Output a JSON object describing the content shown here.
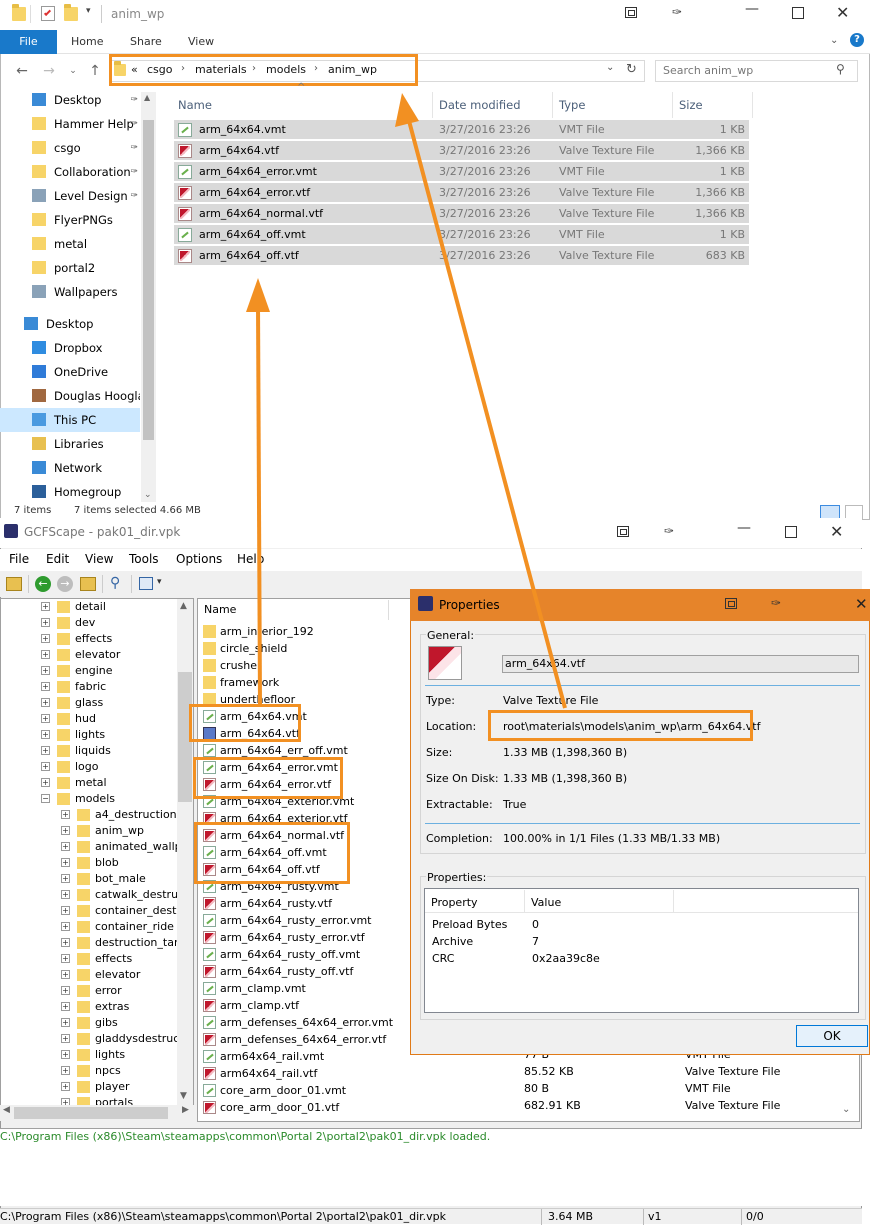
{
  "explorer": {
    "title": "anim_wp",
    "tabs": {
      "file": "File",
      "home": "Home",
      "share": "Share",
      "view": "View"
    },
    "address": {
      "prefix": "«",
      "crumbs": [
        "csgo",
        "materials",
        "models",
        "anim_wp"
      ]
    },
    "search_placeholder": "Search anim_wp",
    "nav": [
      {
        "label": "Desktop",
        "icon": "desktop-icon",
        "pinned": true
      },
      {
        "label": "Hammer Help",
        "icon": "folder-icon",
        "pinned": true
      },
      {
        "label": "csgo",
        "icon": "folder-icon",
        "pinned": true
      },
      {
        "label": "Collaboration",
        "icon": "folder-icon",
        "pinned": true
      },
      {
        "label": "Level Design",
        "icon": "users-folder-icon",
        "pinned": true
      },
      {
        "label": "FlyerPNGs",
        "icon": "folder-icon",
        "pinned": false
      },
      {
        "label": "metal",
        "icon": "folder-icon",
        "pinned": false
      },
      {
        "label": "portal2",
        "icon": "folder-icon",
        "pinned": false
      },
      {
        "label": "Wallpapers",
        "icon": "users-folder-icon",
        "pinned": false
      },
      {
        "label": "Desktop",
        "icon": "desktop-icon",
        "pinned": false
      },
      {
        "label": "Dropbox",
        "icon": "dropbox-icon",
        "pinned": false
      },
      {
        "label": "OneDrive",
        "icon": "cloud-icon",
        "pinned": false
      },
      {
        "label": "Douglas Hoogla",
        "icon": "user-icon",
        "pinned": false
      },
      {
        "label": "This PC",
        "icon": "computer-icon",
        "pinned": false
      },
      {
        "label": "Libraries",
        "icon": "library-icon",
        "pinned": false
      },
      {
        "label": "Network",
        "icon": "network-icon",
        "pinned": false
      },
      {
        "label": "Homegroup",
        "icon": "homegroup-icon",
        "pinned": false
      }
    ],
    "columns": {
      "name": "Name",
      "date": "Date modified",
      "type": "Type",
      "size": "Size"
    },
    "files": [
      {
        "name": "arm_64x64.vmt",
        "date": "3/27/2016 23:26",
        "type": "VMT File",
        "size": "1 KB",
        "kind": "vmt"
      },
      {
        "name": "arm_64x64.vtf",
        "date": "3/27/2016 23:26",
        "type": "Valve Texture File",
        "size": "1,366 KB",
        "kind": "vtf"
      },
      {
        "name": "arm_64x64_error.vmt",
        "date": "3/27/2016 23:26",
        "type": "VMT File",
        "size": "1 KB",
        "kind": "vmt"
      },
      {
        "name": "arm_64x64_error.vtf",
        "date": "3/27/2016 23:26",
        "type": "Valve Texture File",
        "size": "1,366 KB",
        "kind": "vtf"
      },
      {
        "name": "arm_64x64_normal.vtf",
        "date": "3/27/2016 23:26",
        "type": "Valve Texture File",
        "size": "1,366 KB",
        "kind": "vtf"
      },
      {
        "name": "arm_64x64_off.vmt",
        "date": "3/27/2016 23:26",
        "type": "VMT File",
        "size": "1 KB",
        "kind": "vmt"
      },
      {
        "name": "arm_64x64_off.vtf",
        "date": "3/27/2016 23:26",
        "type": "Valve Texture File",
        "size": "683 KB",
        "kind": "vtf"
      }
    ],
    "status_items": "7 items",
    "status_selected": "7 items selected  4.66 MB"
  },
  "gcf": {
    "title": "GCFScape - pak01_dir.vpk",
    "menus": [
      "File",
      "Edit",
      "View",
      "Tools",
      "Options",
      "Help"
    ],
    "tree": [
      {
        "label": "detail",
        "level": 1,
        "expanded": false
      },
      {
        "label": "dev",
        "level": 1,
        "expanded": false
      },
      {
        "label": "effects",
        "level": 1,
        "expanded": false
      },
      {
        "label": "elevator",
        "level": 1,
        "expanded": false
      },
      {
        "label": "engine",
        "level": 1,
        "expanded": false
      },
      {
        "label": "fabric",
        "level": 1,
        "expanded": false
      },
      {
        "label": "glass",
        "level": 1,
        "expanded": false
      },
      {
        "label": "hud",
        "level": 1,
        "expanded": false
      },
      {
        "label": "lights",
        "level": 1,
        "expanded": false
      },
      {
        "label": "liquids",
        "level": 1,
        "expanded": false
      },
      {
        "label": "logo",
        "level": 1,
        "expanded": false
      },
      {
        "label": "metal",
        "level": 1,
        "expanded": false
      },
      {
        "label": "models",
        "level": 1,
        "expanded": true
      },
      {
        "label": "a4_destruction",
        "level": 2,
        "expanded": false
      },
      {
        "label": "anim_wp",
        "level": 2,
        "expanded": false
      },
      {
        "label": "animated_wallpa",
        "level": 2,
        "expanded": false
      },
      {
        "label": "blob",
        "level": 2,
        "expanded": false
      },
      {
        "label": "bot_male",
        "level": 2,
        "expanded": false
      },
      {
        "label": "catwalk_destruct",
        "level": 2,
        "expanded": false
      },
      {
        "label": "container_destru",
        "level": 2,
        "expanded": false
      },
      {
        "label": "container_ride",
        "level": 2,
        "expanded": false
      },
      {
        "label": "destruction_tank",
        "level": 2,
        "expanded": false
      },
      {
        "label": "effects",
        "level": 2,
        "expanded": false
      },
      {
        "label": "elevator",
        "level": 2,
        "expanded": false
      },
      {
        "label": "error",
        "level": 2,
        "expanded": false
      },
      {
        "label": "extras",
        "level": 2,
        "expanded": false
      },
      {
        "label": "gibs",
        "level": 2,
        "expanded": false
      },
      {
        "label": "gladdysdestructio",
        "level": 2,
        "expanded": false
      },
      {
        "label": "lights",
        "level": 2,
        "expanded": false
      },
      {
        "label": "npcs",
        "level": 2,
        "expanded": false
      },
      {
        "label": "player",
        "level": 2,
        "expanded": false
      },
      {
        "label": "portals",
        "level": 2,
        "expanded": false
      }
    ],
    "list_header": "Name",
    "list": [
      {
        "name": "arm_interior_192",
        "kind": "folder"
      },
      {
        "name": "circle_shield",
        "kind": "folder"
      },
      {
        "name": "crusher",
        "kind": "folder"
      },
      {
        "name": "framework",
        "kind": "folder"
      },
      {
        "name": "underthefloor",
        "kind": "folder"
      },
      {
        "name": "arm_64x64.vmt",
        "kind": "vmt"
      },
      {
        "name": "arm_64x64.vtf",
        "kind": "vtf-sel"
      },
      {
        "name": "arm_64x64_err_off.vmt",
        "kind": "vmt"
      },
      {
        "name": "arm_64x64_error.vmt",
        "kind": "vmt"
      },
      {
        "name": "arm_64x64_error.vtf",
        "kind": "vtf"
      },
      {
        "name": "arm_64x64_exterior.vmt",
        "kind": "vmt"
      },
      {
        "name": "arm_64x64_exterior.vtf",
        "kind": "vtf"
      },
      {
        "name": "arm_64x64_normal.vtf",
        "kind": "vtf"
      },
      {
        "name": "arm_64x64_off.vmt",
        "kind": "vmt"
      },
      {
        "name": "arm_64x64_off.vtf",
        "kind": "vtf"
      },
      {
        "name": "arm_64x64_rusty.vmt",
        "kind": "vmt"
      },
      {
        "name": "arm_64x64_rusty.vtf",
        "kind": "vtf"
      },
      {
        "name": "arm_64x64_rusty_error.vmt",
        "kind": "vmt"
      },
      {
        "name": "arm_64x64_rusty_error.vtf",
        "kind": "vtf"
      },
      {
        "name": "arm_64x64_rusty_off.vmt",
        "kind": "vmt"
      },
      {
        "name": "arm_64x64_rusty_off.vtf",
        "kind": "vtf"
      },
      {
        "name": "arm_clamp.vmt",
        "kind": "vmt"
      },
      {
        "name": "arm_clamp.vtf",
        "kind": "vtf"
      },
      {
        "name": "arm_defenses_64x64_error.vmt",
        "kind": "vmt"
      },
      {
        "name": "arm_defenses_64x64_error.vtf",
        "kind": "vtf"
      },
      {
        "name": "arm64x64_rail.vmt",
        "kind": "vmt",
        "size": "77 B",
        "type": "VMT File"
      },
      {
        "name": "arm64x64_rail.vtf",
        "kind": "vtf",
        "size": "85.52 KB",
        "type": "Valve Texture File"
      },
      {
        "name": "core_arm_door_01.vmt",
        "kind": "vmt",
        "size": "80 B",
        "type": "VMT File"
      },
      {
        "name": "core_arm_door_01.vtf",
        "kind": "vtf",
        "size": "682.91 KB",
        "type": "Valve Texture File"
      }
    ],
    "log": "C:\\Program Files (x86)\\Steam\\steamapps\\common\\Portal 2\\portal2\\pak01_dir.vpk loaded.",
    "status": {
      "path": "C:\\Program Files (x86)\\Steam\\steamapps\\common\\Portal 2\\portal2\\pak01_dir.vpk",
      "size": "3.64 MB",
      "version": "v1",
      "count": "0/0"
    }
  },
  "props": {
    "title": "Properties",
    "general": "General:",
    "filename": "arm_64x64.vtf",
    "type_label": "Type:",
    "type_value": "Valve Texture File",
    "location_label": "Location:",
    "location_value": "root\\materials\\models\\anim_wp\\arm_64x64.vtf",
    "size_label": "Size:",
    "size_value": "1.33 MB (1,398,360 B)",
    "disk_label": "Size On Disk:",
    "disk_value": "1.33 MB (1,398,360 B)",
    "extract_label": "Extractable:",
    "extract_value": "True",
    "completion_label": "Completion:",
    "completion_value": "100.00% in 1/1 Files (1.33 MB/1.33 MB)",
    "properties_label": "Properties:",
    "table_headers": {
      "property": "Property",
      "value": "Value"
    },
    "table": [
      {
        "property": "Preload Bytes",
        "value": "0"
      },
      {
        "property": "Archive",
        "value": "7"
      },
      {
        "property": "CRC",
        "value": "0x2aa39c8e"
      }
    ],
    "ok": "OK"
  },
  "colors": {
    "accent": "#1979ca",
    "highlight": "#f29022",
    "props_title": "#e6842a",
    "log_green": "#2a8a2a"
  }
}
